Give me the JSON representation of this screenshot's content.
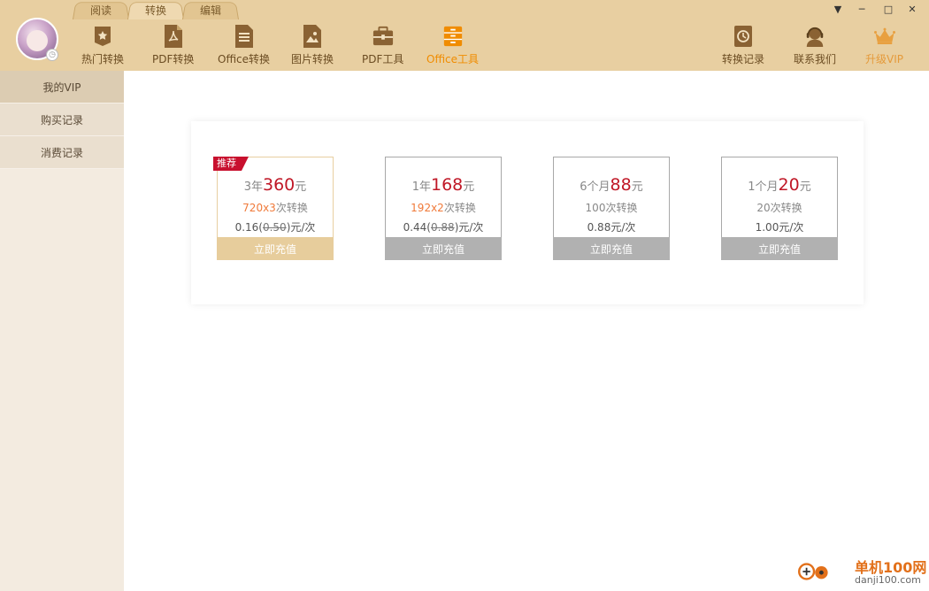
{
  "tabs": [
    {
      "label": "阅读"
    },
    {
      "label": "转换"
    },
    {
      "label": "编辑"
    }
  ],
  "nav": [
    {
      "label": "热门转换",
      "icon": "star-icon"
    },
    {
      "label": "PDF转换",
      "icon": "pdf-icon"
    },
    {
      "label": "Office转换",
      "icon": "document-icon"
    },
    {
      "label": "图片转换",
      "icon": "image-icon"
    },
    {
      "label": "PDF工具",
      "icon": "toolbox-icon"
    },
    {
      "label": "Office工具",
      "icon": "cabinet-icon"
    }
  ],
  "right_nav": [
    {
      "label": "转换记录",
      "icon": "clock-icon"
    },
    {
      "label": "联系我们",
      "icon": "headset-icon"
    },
    {
      "label": "升级VIP",
      "icon": "crown-icon"
    }
  ],
  "sidebar": {
    "items": [
      {
        "label": "我的VIP"
      },
      {
        "label": "购买记录"
      },
      {
        "label": "消费记录"
      }
    ]
  },
  "plans": [
    {
      "badge": "推荐",
      "duration": "3年",
      "price": "360",
      "unit": "元",
      "count_hl": "720x3",
      "count_rest": "次转换",
      "per_price": "0.16",
      "orig_price": "0.50",
      "per_unit": "元/次",
      "button": "立即充值"
    },
    {
      "duration": "1年",
      "price": "168",
      "unit": "元",
      "count_hl": "192x2",
      "count_rest": "次转换",
      "per_price": "0.44",
      "orig_price": "0.88",
      "per_unit": "元/次",
      "button": "立即充值"
    },
    {
      "duration": "6个月",
      "price": "88",
      "unit": "元",
      "count_hl": "",
      "count_rest": "100次转换",
      "per_price": "0.88",
      "orig_price": "",
      "per_unit": "元/次",
      "button": "立即充值"
    },
    {
      "duration": "1个月",
      "price": "20",
      "unit": "元",
      "count_hl": "",
      "count_rest": "20次转换",
      "per_price": "1.00",
      "orig_price": "",
      "per_unit": "元/次",
      "button": "立即充值"
    }
  ],
  "window": {
    "menu": "▼",
    "minimize": "─",
    "maximize": "□",
    "close": "✕"
  },
  "watermark": {
    "name": "单机100网",
    "url": "danji100.com"
  },
  "colors": {
    "header": "#e8cfa1",
    "accent": "#f08c00",
    "price": "#c01827",
    "sidebar": "#f3ebe0"
  }
}
